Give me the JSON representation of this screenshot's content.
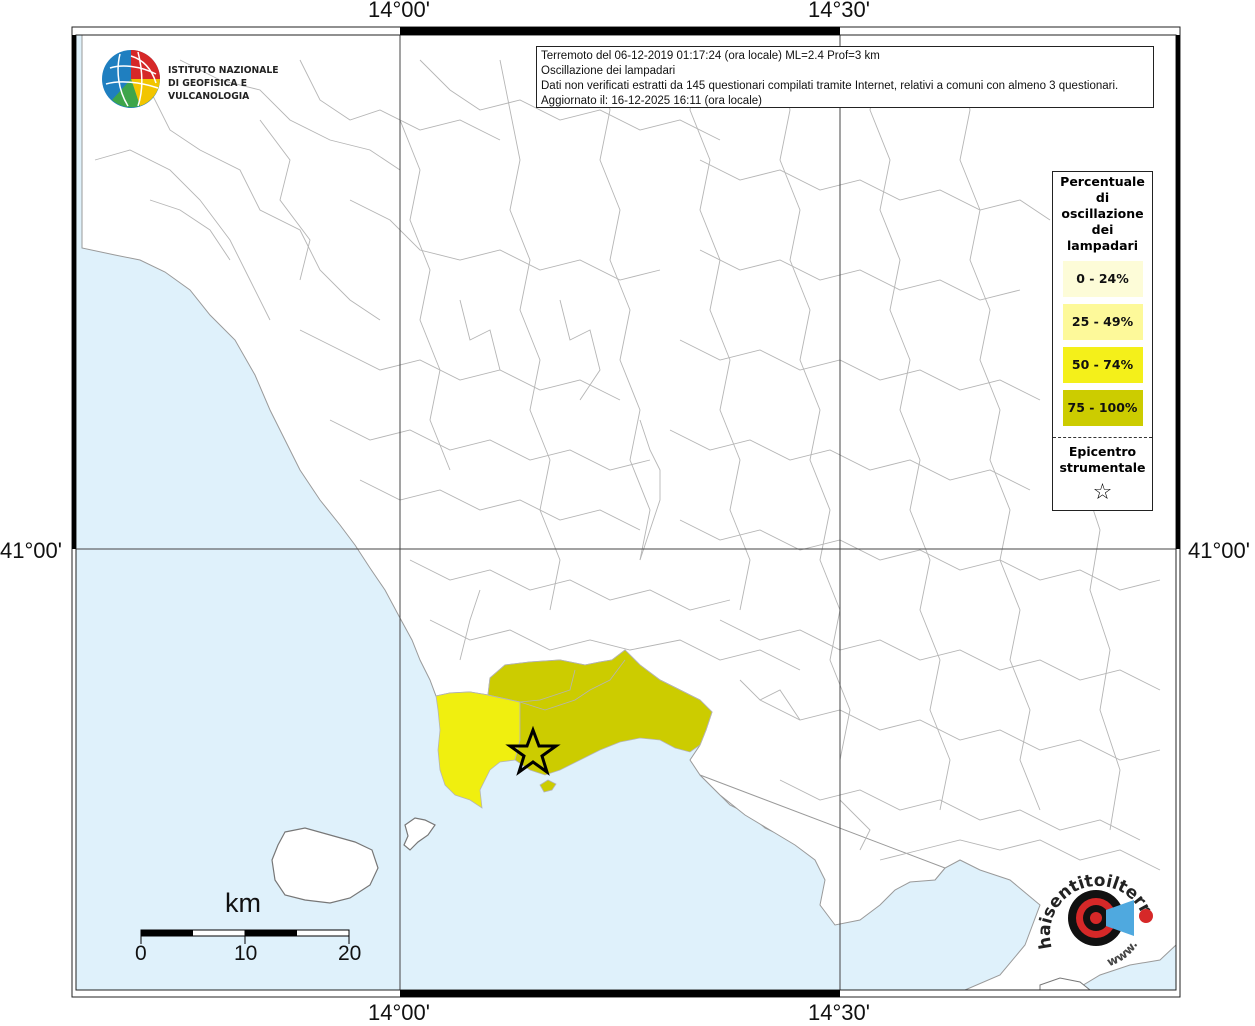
{
  "ticks": {
    "lon_1": "14°00'",
    "lon_2": "14°30'",
    "lat_1": "41°00'"
  },
  "title": {
    "line1": "Terremoto del 06-12-2019 01:17:24 (ora locale) ML=2.4 Prof=3 km",
    "line2": "Oscillazione dei lampadari",
    "line3": "Dati non verificati estratti da 145 questionari compilati tramite Internet, relativi a comuni con almeno 3 questionari.",
    "line4": "Aggiornato il: 16-12-2025 16:11 (ora locale)"
  },
  "logo": {
    "line1": "ISTITUTO NAZIONALE",
    "line2": "DI GEOFISICA E VULCANOLOGIA"
  },
  "legend": {
    "title_lines": [
      "Percentuale",
      "di",
      "oscillazione",
      "dei",
      "lampadari"
    ],
    "classes": [
      {
        "label": "0 - 24%",
        "color": "#fdfcd8"
      },
      {
        "label": "25 - 49%",
        "color": "#fdf99a"
      },
      {
        "label": "50 - 74%",
        "color": "#f4f01a"
      },
      {
        "label": "75 - 100%",
        "color": "#cccc00"
      }
    ],
    "epicenter_lines": [
      "Epicentro",
      "strumentale"
    ],
    "epicenter_symbol": "☆"
  },
  "scale": {
    "unit": "km",
    "labels": [
      "0",
      "10",
      "20"
    ]
  },
  "hsi_logo": {
    "text": "haisentitoilterremoto.it",
    "www": "www."
  },
  "colors": {
    "sea": "#dff1fb",
    "land": "#ffffff",
    "boundary": "#b5b5b5",
    "grid": "#444444",
    "class_50_74": "#f0ef0f",
    "class_75_100": "#cccc00"
  },
  "epicenter": {
    "lat": "40.83",
    "lon": "14.15"
  }
}
